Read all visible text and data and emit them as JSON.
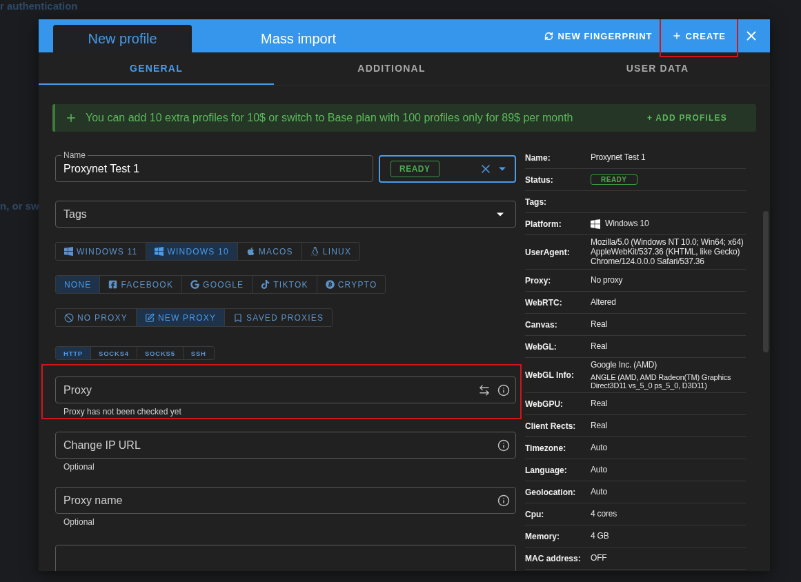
{
  "background": {
    "heading": "r authentication",
    "fragment": "n, or sw"
  },
  "dialog": {
    "tabs": [
      {
        "label": "New profile",
        "selected": true
      },
      {
        "label": "Mass import",
        "selected": false
      }
    ],
    "actions": [
      {
        "label": "NEW FINGERPRINT",
        "kind": "refresh",
        "highlighted": false
      },
      {
        "label": "CREATE",
        "kind": "add",
        "highlighted": true
      }
    ],
    "subtabs": [
      {
        "label": "GENERAL",
        "selected": true
      },
      {
        "label": "ADDITIONAL",
        "selected": false
      },
      {
        "label": "USER DATA",
        "selected": false
      }
    ],
    "banner": {
      "text": "You can add 10 extra profiles for 10$ or switch to Base plan with 100 profiles only for 89$ per month",
      "action": "+ ADD PROFILES"
    },
    "form": {
      "name": {
        "label": "Name",
        "value": "Proxynet Test 1"
      },
      "status": {
        "chip": "READY",
        "focused": true
      },
      "tags": {
        "placeholder": "Tags"
      },
      "groups": [
        {
          "kind": "large",
          "options": [
            {
              "label": "WINDOWS 11",
              "kind": "windows",
              "selected": false
            },
            {
              "label": "WINDOWS 10",
              "kind": "windows",
              "selected": true
            },
            {
              "label": "MACOS",
              "kind": "apple",
              "selected": false
            },
            {
              "label": "LINUX",
              "kind": "linux",
              "selected": false
            }
          ]
        },
        {
          "kind": "large",
          "options": [
            {
              "label": "NONE",
              "kind": "plain",
              "selected": true
            },
            {
              "label": "FACEBOOK",
              "kind": "facebook",
              "selected": false
            },
            {
              "label": "GOOGLE",
              "kind": "google",
              "selected": false
            },
            {
              "label": "TIKTOK",
              "kind": "tiktok",
              "selected": false
            },
            {
              "label": "CRYPTO",
              "kind": "bitcoin",
              "selected": false
            }
          ]
        },
        {
          "kind": "large",
          "options": [
            {
              "label": "NO PROXY",
              "kind": "ban",
              "selected": false
            },
            {
              "label": "NEW PROXY",
              "kind": "edit",
              "selected": true
            },
            {
              "label": "SAVED PROXIES",
              "kind": "bookmark",
              "selected": false
            }
          ]
        },
        {
          "kind": "small",
          "options": [
            {
              "label": "HTTP",
              "kind": "plain",
              "selected": true
            },
            {
              "label": "SOCKS4",
              "kind": "plain",
              "selected": false
            },
            {
              "label": "SOCKS5",
              "kind": "plain",
              "selected": false
            },
            {
              "label": "SSH",
              "kind": "plain",
              "selected": false
            }
          ]
        }
      ],
      "fields": [
        {
          "placeholder": "Proxy",
          "helper": "Proxy has not been checked yet",
          "swap": true,
          "highlighted": true
        },
        {
          "placeholder": "Change IP URL",
          "helper": "Optional",
          "swap": false,
          "highlighted": false
        },
        {
          "placeholder": "Proxy name",
          "helper": "Optional",
          "swap": false,
          "highlighted": false
        }
      ]
    },
    "summary": [
      {
        "label": "Name:",
        "kind": "text",
        "value": "Proxynet Test 1"
      },
      {
        "label": "Status:",
        "kind": "chip",
        "value": "READY"
      },
      {
        "label": "Tags:",
        "kind": "empty"
      },
      {
        "label": "Platform:",
        "kind": "platform",
        "value": "Windows 10"
      },
      {
        "label": "UserAgent:",
        "kind": "text",
        "value": "Mozilla/5.0 (Windows NT 10.0; Win64; x64) AppleWebKit/537.36 (KHTML, like Gecko) Chrome/124.0.0.0 Safari/537.36"
      },
      {
        "label": "Proxy:",
        "kind": "text",
        "value": "No proxy"
      },
      {
        "label": "WebRTC:",
        "kind": "text",
        "value": "Altered"
      },
      {
        "label": "Canvas:",
        "kind": "text",
        "value": "Real"
      },
      {
        "label": "WebGL:",
        "kind": "text",
        "value": "Real"
      },
      {
        "label": "WebGL Info:",
        "kind": "multi",
        "value": "Google Inc. (AMD)",
        "detail": "ANGLE (AMD, AMD Radeon(TM) Graphics Direct3D11 vs_5_0 ps_5_0, D3D11)"
      },
      {
        "label": "WebGPU:",
        "kind": "text",
        "value": "Real"
      },
      {
        "label": "Client Rects:",
        "kind": "text",
        "value": "Real"
      },
      {
        "label": "Timezone:",
        "kind": "text",
        "value": "Auto"
      },
      {
        "label": "Language:",
        "kind": "text",
        "value": "Auto"
      },
      {
        "label": "Geolocation:",
        "kind": "text",
        "value": "Auto"
      },
      {
        "label": "Cpu:",
        "kind": "text",
        "value": "4 cores"
      },
      {
        "label": "Memory:",
        "kind": "text",
        "value": "4 GB"
      },
      {
        "label": "MAC address:",
        "kind": "text",
        "value": "OFF"
      }
    ]
  }
}
